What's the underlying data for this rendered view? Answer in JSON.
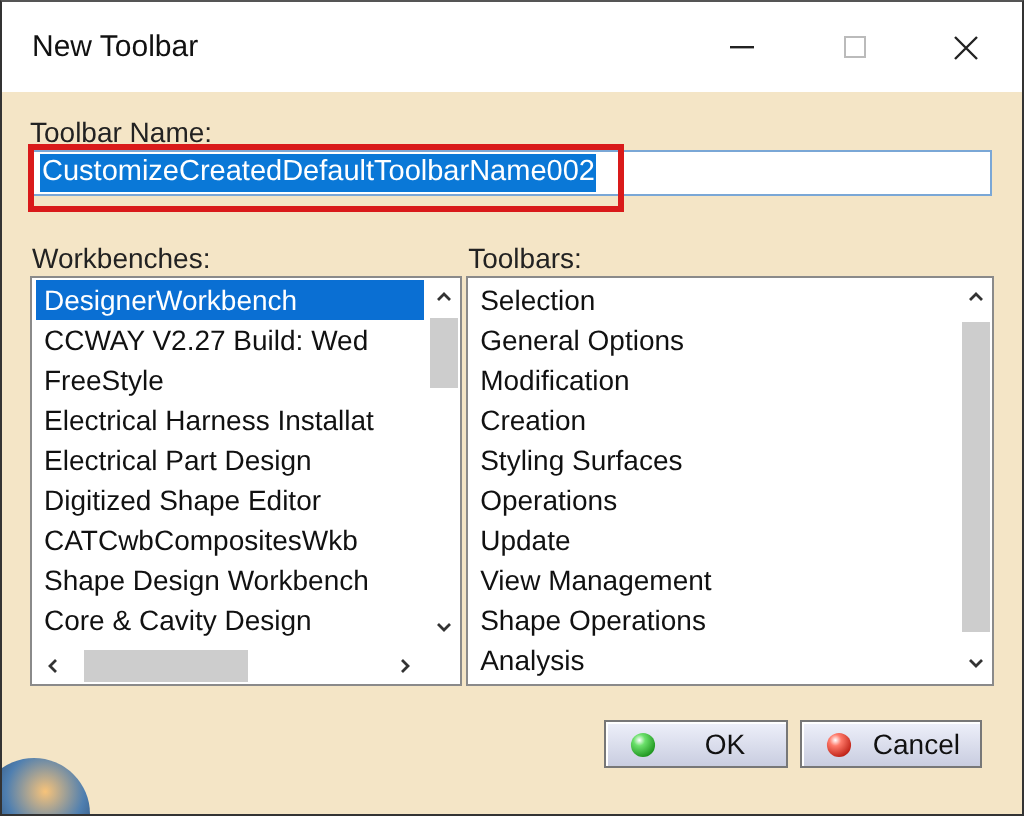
{
  "window": {
    "title": "New Toolbar"
  },
  "toolbar_name": {
    "label": "Toolbar Name:",
    "value": "CustomizeCreatedDefaultToolbarName002",
    "text_selected": true,
    "highlighted": true
  },
  "workbenches": {
    "label": "Workbenches:",
    "items": [
      {
        "label": "DesignerWorkbench",
        "selected": true
      },
      {
        "label": "CCWAY V2.27 Build: Wed",
        "selected": false
      },
      {
        "label": "FreeStyle",
        "selected": false
      },
      {
        "label": "Electrical Harness Installat",
        "selected": false
      },
      {
        "label": "Electrical Part Design",
        "selected": false
      },
      {
        "label": "Digitized Shape Editor",
        "selected": false
      },
      {
        "label": "CATCwbCompositesWkb",
        "selected": false
      },
      {
        "label": "Shape Design Workbench",
        "selected": false
      },
      {
        "label": "Core & Cavity Design",
        "selected": false
      }
    ]
  },
  "toolbars": {
    "label": "Toolbars:",
    "items": [
      {
        "label": "Selection",
        "selected": false
      },
      {
        "label": "General Options",
        "selected": false
      },
      {
        "label": "Modification",
        "selected": false
      },
      {
        "label": "Creation",
        "selected": false
      },
      {
        "label": "Styling Surfaces",
        "selected": false
      },
      {
        "label": "Operations",
        "selected": false
      },
      {
        "label": "Update",
        "selected": false
      },
      {
        "label": "View Management",
        "selected": false
      },
      {
        "label": "Shape Operations",
        "selected": false
      },
      {
        "label": "Analysis",
        "selected": false
      }
    ]
  },
  "buttons": [
    {
      "label": "OK",
      "kind": "ok"
    },
    {
      "label": "Cancel",
      "kind": "cancel"
    }
  ]
}
